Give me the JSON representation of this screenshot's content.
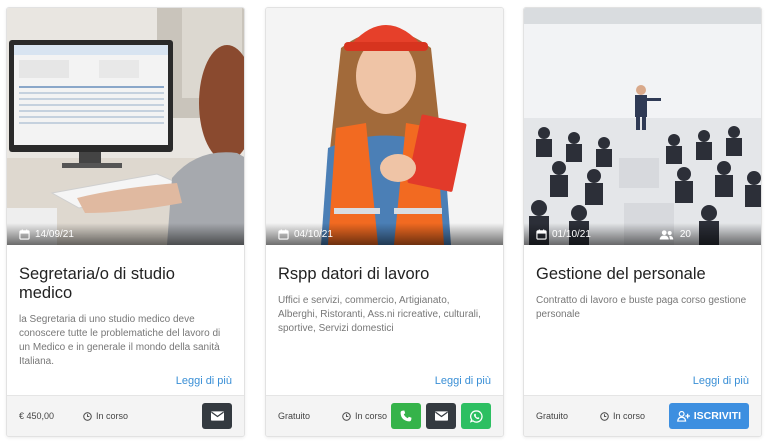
{
  "cards": [
    {
      "date": "14/09/21",
      "title": "Segretaria/o di studio medico",
      "description": "la Segretaria di uno studio medico deve conoscere tutte le problematiche del lavoro di un Medico e in generale il mondo della sanità Italiana.",
      "more_label": "Leggi di più",
      "price": "€ 450,00",
      "status": "In corso",
      "image": "woman-at-computer-photo"
    },
    {
      "date": "04/10/21",
      "title": "Rspp datori di lavoro",
      "description": "Uffici e servizi, commercio, Artigianato, Alberghi, Ristoranti, Ass.ni ricreative, culturali, sportive, Servizi domestici",
      "more_label": "Leggi di più",
      "price": "Gratuito",
      "status": "In corso",
      "image": "worker-in-safety-vest-photo"
    },
    {
      "date": "01/10/21",
      "participants": "20",
      "title": "Gestione del personale",
      "description": "Contratto di lavoro e buste paga corso gestione personale",
      "more_label": "Leggi di più",
      "price": "Gratuito",
      "status": "In corso",
      "button_label": "ISCRIVITI",
      "image": "conference-audience-photo"
    }
  ],
  "colors": {
    "link": "#3a8fd6",
    "dark_button": "#343a40",
    "phone_button": "#35b34a",
    "whatsapp_button": "#2dbf62",
    "primary_button": "#3d8fe0"
  },
  "icons": {
    "date": "calendar-icon",
    "participants": "users-icon",
    "status": "clock-icon",
    "email": "envelope-icon",
    "phone": "phone-icon",
    "whatsapp": "whatsapp-icon",
    "enroll": "user-plus-icon"
  }
}
